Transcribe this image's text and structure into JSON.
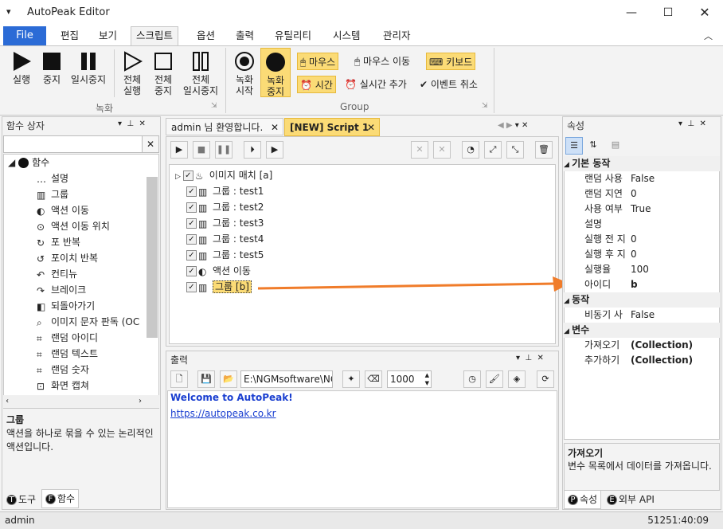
{
  "app": {
    "title": "AutoPeak Editor"
  },
  "menu_tabs": [
    "File",
    "편집",
    "보기",
    "스크립트",
    "옵션",
    "출력",
    "유틸리티",
    "시스템",
    "관리자"
  ],
  "ribbon": {
    "rec_group_buttons": [
      {
        "label": "실행"
      },
      {
        "label": "중지"
      },
      {
        "label": "일시중지"
      }
    ],
    "full_buttons": [
      {
        "label1": "전체",
        "label2": "실행"
      },
      {
        "label1": "전체",
        "label2": "중지"
      },
      {
        "label1": "전체",
        "label2": "일시중지"
      }
    ],
    "rec_group_label": "녹화",
    "rec_start": {
      "label1": "녹화",
      "label2": "시작"
    },
    "rec_stop": {
      "label1": "녹화",
      "label2": "중지"
    },
    "mouse": "마우스",
    "mouse_move": "마우스 이동",
    "keyboard": "키보드",
    "time": "시간",
    "realtime_add": "실시간 추가",
    "event_cancel": "이벤트 취소",
    "group_label": "Group"
  },
  "left_panel": {
    "title": "함수 상자",
    "root": "함수",
    "items": [
      "설명",
      "그룹",
      "액션 이동",
      "액션 이동 위치",
      "포 반복",
      "포이치 반복",
      "컨티뉴",
      "브레이크",
      "되돌아가기",
      "이미지 문자 판독 (OC",
      "랜덤 아이디",
      "랜덤 텍스트",
      "랜덤 숫자",
      "화면 캡쳐"
    ],
    "desc_title": "그룹",
    "desc_text": "액션을 하나로 묶을 수 있는 논리적인 액션입니다.",
    "tabs": [
      "도구",
      "함수"
    ]
  },
  "doc_tabs": [
    "admin 님 환영합니다.",
    "[NEW] Script 1"
  ],
  "script_tree": {
    "items": [
      "이미지 매치 [a]",
      "그룹 : test1",
      "그룹 : test2",
      "그룹 : test3",
      "그룹 : test4",
      "그룹 : test5",
      "액션 이동",
      "그룹 [b]"
    ]
  },
  "output": {
    "title": "출력",
    "path": "E:\\NGMsoftware\\NG",
    "count": "1000",
    "welcome": "Welcome to AutoPeak!",
    "link": "https://autopeak.co.kr"
  },
  "properties": {
    "title": "속성",
    "cat1": "기본 동작",
    "rows1": [
      {
        "k": "랜덤 사용",
        "v": "False"
      },
      {
        "k": "랜덤 지연",
        "v": "0"
      },
      {
        "k": "사용 여부",
        "v": "True"
      },
      {
        "k": "설명",
        "v": ""
      },
      {
        "k": "실행 전 지",
        "v": "0"
      },
      {
        "k": "실행 후 지",
        "v": "0"
      },
      {
        "k": "실행율",
        "v": "100"
      },
      {
        "k": "아이디",
        "v": "b"
      }
    ],
    "cat2": "동작",
    "rows2": [
      {
        "k": "비동기 사",
        "v": "False"
      }
    ],
    "cat3": "변수",
    "rows3": [
      {
        "k": "가져오기",
        "v": "(Collection)"
      },
      {
        "k": "추가하기",
        "v": "(Collection)"
      }
    ],
    "desc_title": "가져오기",
    "desc_text": "변수 목록에서 데이터를 가져옵니다.",
    "tabs": [
      "속성",
      "외부 API"
    ]
  },
  "status": {
    "user": "admin",
    "time": "51251:40:09"
  },
  "colors": {
    "accent": "#2b6bd6",
    "highlight": "#fbdb76",
    "arrow": "#f07c2a",
    "link": "#1a3fd0"
  }
}
